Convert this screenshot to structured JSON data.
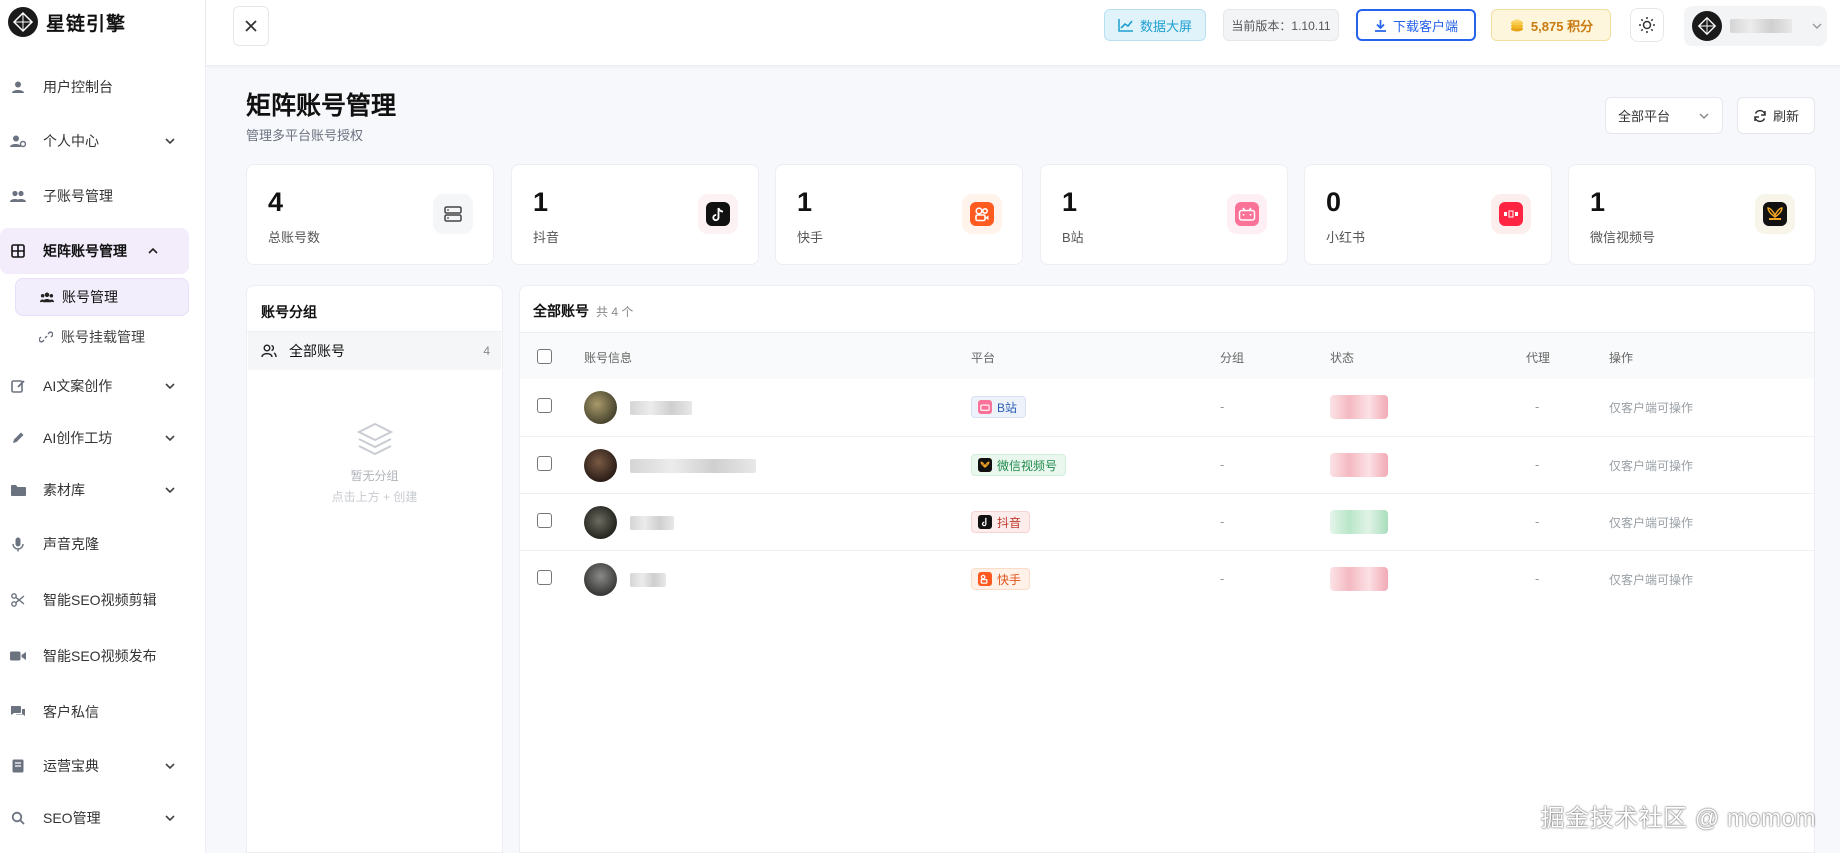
{
  "brand": {
    "name": "星链引擎"
  },
  "sidebar": {
    "items": [
      {
        "label": "用户控制台",
        "icon": "user-icon"
      },
      {
        "label": "个人中心",
        "icon": "user-cog-icon"
      },
      {
        "label": "子账号管理",
        "icon": "users-icon"
      },
      {
        "label": "矩阵账号管理",
        "icon": "grid-icon"
      },
      {
        "label": "账号管理",
        "icon": "team-icon"
      },
      {
        "label": "账号挂载管理",
        "icon": "link-icon"
      },
      {
        "label": "AI文案创作",
        "icon": "edit-icon"
      },
      {
        "label": "AI创作工坊",
        "icon": "pencil-icon"
      },
      {
        "label": "素材库",
        "icon": "folder-icon"
      },
      {
        "label": "声音克隆",
        "icon": "mic-icon"
      },
      {
        "label": "智能SEO视频剪辑",
        "icon": "scissors-icon"
      },
      {
        "label": "智能SEO视频发布",
        "icon": "video-icon"
      },
      {
        "label": "客户私信",
        "icon": "chat-icon"
      },
      {
        "label": "运营宝典",
        "icon": "book-icon"
      },
      {
        "label": "SEO管理",
        "icon": "search-icon"
      }
    ]
  },
  "topbar": {
    "dashboard_label": "数据大屏",
    "version_label": "当前版本：1.10.11",
    "download_label": "下载客户端",
    "points_label": "5,875 积分"
  },
  "page": {
    "title": "矩阵账号管理",
    "subtitle": "管理多平台账号授权",
    "platform_filter": "全部平台",
    "refresh_label": "刷新"
  },
  "stats": [
    {
      "value": "4",
      "label": "总账号数",
      "icon": "server-icon"
    },
    {
      "value": "1",
      "label": "抖音",
      "icon": "douyin-icon"
    },
    {
      "value": "1",
      "label": "快手",
      "icon": "kuaishou-icon"
    },
    {
      "value": "1",
      "label": "B站",
      "icon": "bilibili-icon"
    },
    {
      "value": "0",
      "label": "小红书",
      "icon": "xiaohongshu-icon"
    },
    {
      "value": "1",
      "label": "微信视频号",
      "icon": "wechat-channels-icon"
    }
  ],
  "groups": {
    "title": "账号分组",
    "all_label": "全部账号",
    "all_count": "4",
    "empty_title": "暂无分组",
    "empty_hint": "点击上方 + 创建"
  },
  "table": {
    "title": "全部账号",
    "count_label": "共 4 个",
    "headers": {
      "info": "账号信息",
      "platform": "平台",
      "group": "分组",
      "status": "状态",
      "proxy": "代理",
      "action": "操作"
    },
    "rows": [
      {
        "platform": "B站",
        "group": "-",
        "proxy": "-",
        "action": "仅客户端可操作"
      },
      {
        "platform": "微信视频号",
        "group": "-",
        "proxy": "-",
        "action": "仅客户端可操作"
      },
      {
        "platform": "抖音",
        "group": "-",
        "proxy": "-",
        "action": "仅客户端可操作"
      },
      {
        "platform": "快手",
        "group": "-",
        "proxy": "-",
        "action": "仅客户端可操作"
      }
    ]
  },
  "watermark": "掘金技术社区 @ momom",
  "colors": {
    "accent_purple": "#f2ecfb",
    "download_blue": "#2563eb",
    "points_gold": "#c97a10",
    "douyin": "#111111",
    "kuaishou": "#ff5a1f",
    "bilibili": "#fb7299",
    "xiaohongshu": "#ff2442",
    "wechat_channels": "#f5a623"
  }
}
